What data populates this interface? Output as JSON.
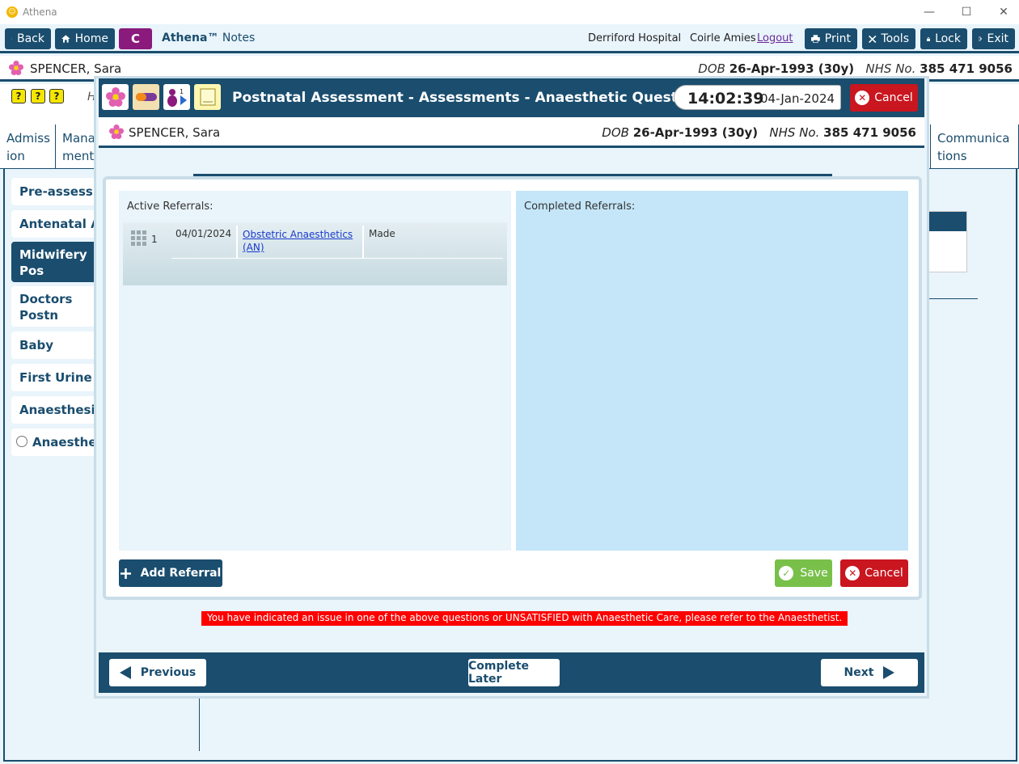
{
  "window": {
    "title": "Athena",
    "minimize": "—",
    "maximize": "☐",
    "close": "✕"
  },
  "toolbar": {
    "back": "Back",
    "home": "Home",
    "c_label": "C",
    "brand_name": "Athena™",
    "brand_suffix": "Notes",
    "hospital": "Derriford Hospital",
    "user": "Coirle Amies",
    "logout": "Logout",
    "print": "Print",
    "tools": "Tools",
    "lock": "Lock",
    "exit": "Exit"
  },
  "patient": {
    "name": "SPENCER, Sara",
    "dob_label": "DOB",
    "dob": "26-Apr-1993 (30y)",
    "nhs_label": "NHS No.",
    "nhs": "385 471 9056"
  },
  "background": {
    "header_letter": "H",
    "tabs": [
      {
        "label": "Admiss ion"
      },
      {
        "label": "Mana ment"
      },
      {
        "label": "Communica tions"
      }
    ],
    "sidebar": [
      {
        "label": "Pre-assessmen"
      },
      {
        "label": "Antenatal Ass"
      },
      {
        "label": "Midwifery Pos Assessments"
      },
      {
        "label": "Doctors Postn Assessments"
      },
      {
        "label": "Baby"
      },
      {
        "label": "First Urine Voi"
      },
      {
        "label": "Anaesthesia In"
      },
      {
        "label": "Anaesthesia"
      }
    ]
  },
  "modal": {
    "title": "Postnatal Assessment - Assessments - Anaesthetic Questions",
    "time": "14:02:39",
    "date": "04-Jan-2024",
    "cancel": "Cancel",
    "active_label": "Active Referrals:",
    "completed_label": "Completed Referrals:",
    "referrals": [
      {
        "num": "1",
        "date": "04/01/2024",
        "name": "Obstetric Anaesthetics (AN)",
        "status": "Made"
      }
    ],
    "add_referral": "Add Referral",
    "save": "Save",
    "cancel_bottom": "Cancel",
    "warning": "You have indicated an issue in one of the above questions or UNSATISFIED with Anaesthetic Care, please refer to the Anaesthetist.",
    "previous": "Previous",
    "complete_later": "Complete Later",
    "next": "Next"
  },
  "colors": {
    "primary": "#1a4d6e",
    "danger": "#c9161f",
    "success": "#78c04a",
    "accent_purple": "#8a1a7c"
  }
}
